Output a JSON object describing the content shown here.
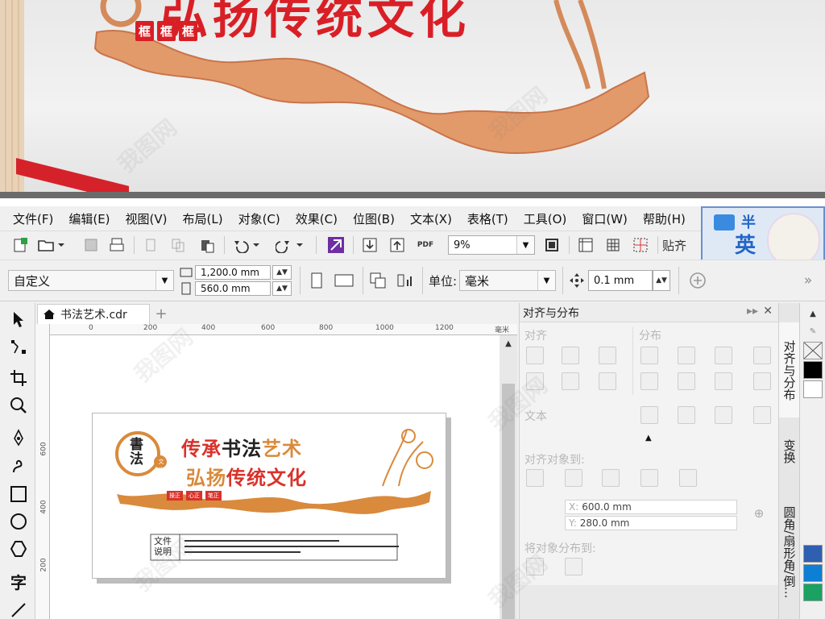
{
  "preview": {
    "title": "弘扬传统文化",
    "tags": [
      "框",
      "框",
      "框"
    ]
  },
  "menu": [
    "文件(F)",
    "编辑(E)",
    "视图(V)",
    "布局(L)",
    "对象(C)",
    "效果(C)",
    "位图(B)",
    "文本(X)",
    "表格(T)",
    "工具(O)",
    "窗口(W)",
    "帮助(H)"
  ],
  "logo_badge": {
    "half": "半",
    "en": "英"
  },
  "toolbar1": {
    "zoom": "9%",
    "snap_label": "贴齐"
  },
  "toolbar2": {
    "page_size": "自定义",
    "width": "1,200.0 mm",
    "height": "560.0 mm",
    "units_label": "单位:",
    "units_value": "毫米",
    "nudge": "0.1 mm"
  },
  "document": {
    "tab_name": "书法艺术.cdr",
    "ruler_unit": "毫米",
    "ruler_h_ticks": [
      "0",
      "200",
      "400",
      "600",
      "800",
      "1000",
      "1200"
    ],
    "ruler_v_ticks": [
      "600",
      "400",
      "200"
    ]
  },
  "design": {
    "badge_chars": [
      "書",
      "法"
    ],
    "badge_small": "文化",
    "line1": [
      "传承",
      "书法",
      "艺术"
    ],
    "line2": [
      "弘扬",
      "传统文化"
    ],
    "mini_tags": [
      "操正",
      "心正",
      "笔正"
    ],
    "info_label": [
      "文件",
      "说明"
    ]
  },
  "docker": {
    "title": "对齐与分布",
    "align": "对齐",
    "distribute": "分布",
    "text": "文本",
    "align_to": "对齐对象到:",
    "x_value": "600.0 mm",
    "y_value": "280.0 mm",
    "x_label": "X:",
    "y_label": "Y:",
    "distribute_to": "将对象分布到:"
  },
  "side_tabs": [
    "对齐与分布",
    "变换",
    "圆角/扇形角/倒..."
  ],
  "palette": [
    "#ffffff",
    "#000000",
    "#ffffff",
    "#2f5fb0",
    "#0d7fd4",
    "#1aa262"
  ],
  "watermark": "我图网"
}
